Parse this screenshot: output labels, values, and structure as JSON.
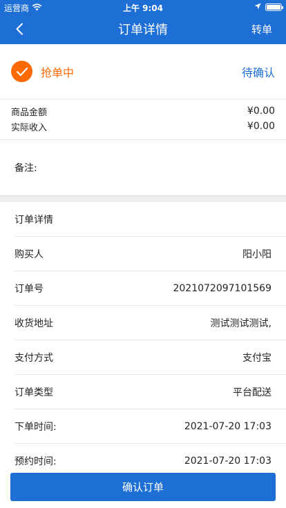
{
  "status_bar": {
    "carrier": "运营商",
    "time": "上午 9:04"
  },
  "nav": {
    "title": "订单详情",
    "action": "转单"
  },
  "order_status": {
    "left": "抢单中",
    "right": "待确认"
  },
  "amounts": [
    {
      "label": "商品金额",
      "value": "¥0.00"
    },
    {
      "label": "实际收入",
      "value": "¥0.00"
    }
  ],
  "remark": {
    "label": "备注:"
  },
  "details": {
    "header": "订单详情",
    "rows": [
      {
        "label": "购买人",
        "value": "阳小阳"
      },
      {
        "label": "订单号",
        "value": "2021072097101569"
      },
      {
        "label": "收货地址",
        "value": "测试测试测试,"
      },
      {
        "label": "支付方式",
        "value": "支付宝"
      },
      {
        "label": "订单类型",
        "value": "平台配送"
      },
      {
        "label": "下单时间:",
        "value": "2021-07-20 17:03"
      },
      {
        "label": "预约时间:",
        "value": "2021-07-20 17:03"
      }
    ]
  },
  "confirm_button": "确认订单",
  "colors": {
    "primary": "#1d6fd6",
    "accent": "#ff6a00"
  },
  "battery_level": 1.0
}
